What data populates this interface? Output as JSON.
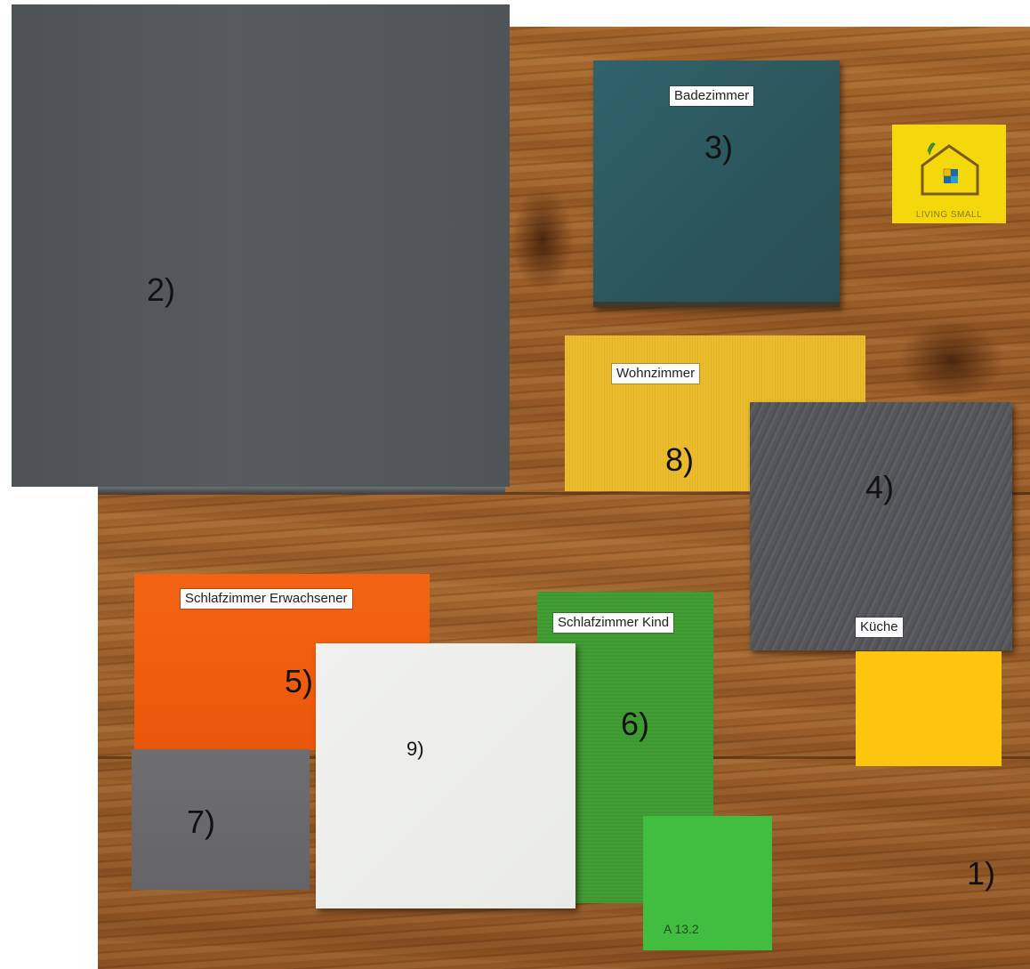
{
  "labels": {
    "bathroom": "Badezimmer",
    "living": "Wohnzimmer",
    "bedroom_adults": "Schlafzimmer Erwachsener",
    "bedroom_child": "Schlafzimmer Kind",
    "kitchen": "Küche"
  },
  "numbers": {
    "n1": "1)",
    "n2": "2)",
    "n3": "3)",
    "n4": "4)",
    "n5": "5)",
    "n6": "6)",
    "n7": "7)",
    "n8": "8)",
    "n9": "9)"
  },
  "card_code": "A 13.2",
  "logo_text": "LIVING SMALL",
  "colors": {
    "wood": "#a0622a",
    "anthracite_panel": "#50565a",
    "petrol_tile": "#2e5960",
    "yellow_fabric": "#e9b82a",
    "grey_felt": "#545559",
    "yellow_card": "#fcc60f",
    "orange_fabric": "#f05e10",
    "white_tile": "#ecedea",
    "green_fabric": "#3f9a32",
    "green_card": "#41bd3f",
    "grey_fabric": "#6c6b6e",
    "logo_yellow": "#f4d80c"
  }
}
